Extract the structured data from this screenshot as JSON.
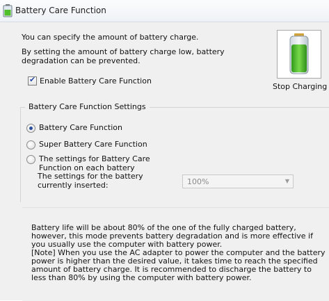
{
  "window": {
    "title": "Battery Care Function"
  },
  "intro": {
    "line1": "You can specify the amount of battery charge.",
    "line2": "By setting the amount of battery charge low, battery degradation can be prevented."
  },
  "enable": {
    "label": "Enable Battery Care Function",
    "checked": true
  },
  "battery_panel": {
    "caption": "Stop Charging",
    "icon": "battery-icon",
    "charge_fraction": 0.8
  },
  "settings": {
    "group_label": "Battery Care Function Settings",
    "options": [
      {
        "label": "Battery Care Function",
        "selected": true
      },
      {
        "label": "Super Battery Care Function",
        "selected": false
      },
      {
        "label": "The settings for Battery Care Function on each battery",
        "selected": false
      }
    ],
    "sub_label": "The settings for the battery currently inserted:",
    "dropdown_value": "100%"
  },
  "note": {
    "paragraph1": "Battery life will be about 80% of the one of the fully charged battery, however, this mode prevents battery degradation and is more effective if you usually use the computer with battery power.",
    "paragraph2": "[Note] When you use the AC adapter to power the computer and the battery power is higher than the desired value, it takes time to reach the specified amount of battery charge. It is recommended to discharge the battery to less than 80% by using the computer with battery power."
  },
  "colors": {
    "battery_green": "#4fbf2a",
    "accent": "#2b4e9a"
  }
}
